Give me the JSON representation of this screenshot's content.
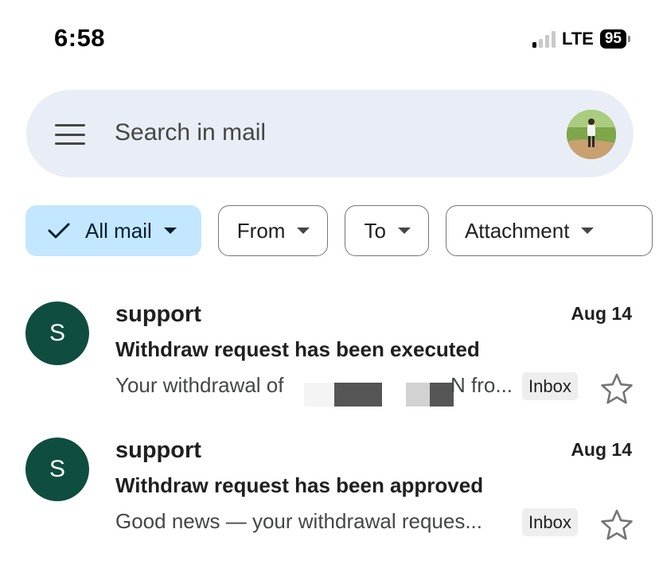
{
  "status_bar": {
    "time": "6:58",
    "network": "LTE",
    "battery": "95"
  },
  "search": {
    "placeholder": "Search in mail",
    "menu_icon": "hamburger-menu-icon",
    "avatar_icon": "profile-avatar"
  },
  "filters": [
    {
      "label": "All mail",
      "selected": true
    },
    {
      "label": "From",
      "selected": false
    },
    {
      "label": "To",
      "selected": false
    },
    {
      "label": "Attachment",
      "selected": false
    }
  ],
  "emails": [
    {
      "avatar_letter": "S",
      "sender": "support",
      "date": "Aug 14",
      "subject": "Withdraw request has been executed",
      "snippet_start": "Your withdrawal of",
      "snippet_end": "N fro...",
      "label": "Inbox",
      "starred": false
    },
    {
      "avatar_letter": "S",
      "sender": "support",
      "date": "Aug 14",
      "subject": "Withdraw request has been approved",
      "snippet": "Good news — your withdrawal reques...",
      "label": "Inbox",
      "starred": false
    }
  ],
  "colors": {
    "search_bg": "#e9eef6",
    "chip_active_bg": "#c2e7ff",
    "avatar_bg": "#0e4d3f",
    "label_bg": "#eeeeee"
  }
}
